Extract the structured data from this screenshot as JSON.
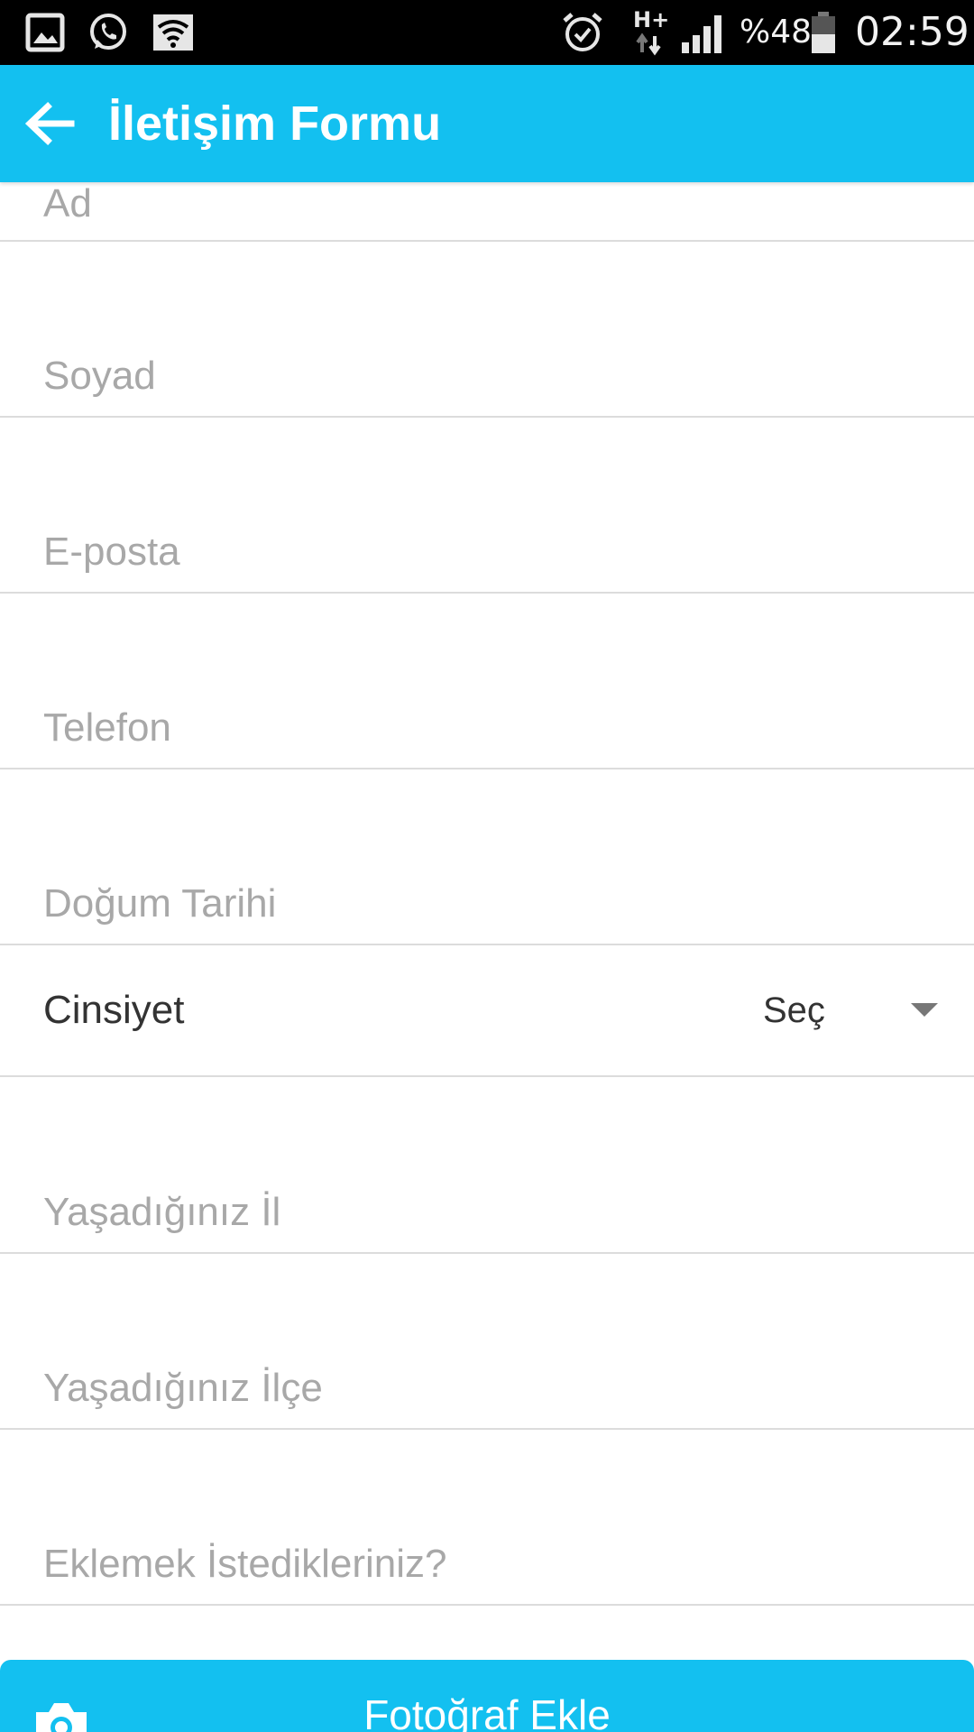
{
  "status_bar": {
    "left_icons": [
      "gallery-icon",
      "whatsapp-icon",
      "wifi-icon"
    ],
    "right_icons": [
      "alarm-icon",
      "network-hplus-icon",
      "signal-icon",
      "battery-icon"
    ],
    "network_type": "H+",
    "battery_percent": "%48",
    "battery_level": 0.48,
    "time": "02:59"
  },
  "app_bar": {
    "title": "İletişim Formu",
    "back_icon": "arrow-left-icon",
    "background_color": "#13c0f0"
  },
  "form": {
    "fields": [
      {
        "placeholder": "Ad",
        "value": ""
      },
      {
        "placeholder": "Soyad",
        "value": ""
      },
      {
        "placeholder": "E-posta",
        "value": ""
      },
      {
        "placeholder": "Telefon",
        "value": ""
      },
      {
        "placeholder": "Doğum Tarihi",
        "value": ""
      }
    ],
    "gender": {
      "label": "Cinsiyet",
      "selected": "Seç"
    },
    "fields_after": [
      {
        "placeholder": "Yaşadığınız İl",
        "value": ""
      },
      {
        "placeholder": "Yaşadığınız İlçe",
        "value": ""
      },
      {
        "placeholder": "Eklemek İstedikleriniz?",
        "value": ""
      }
    ]
  },
  "photo_button": {
    "label": "Fotoğraf Ekle",
    "icon": "camera-icon"
  }
}
